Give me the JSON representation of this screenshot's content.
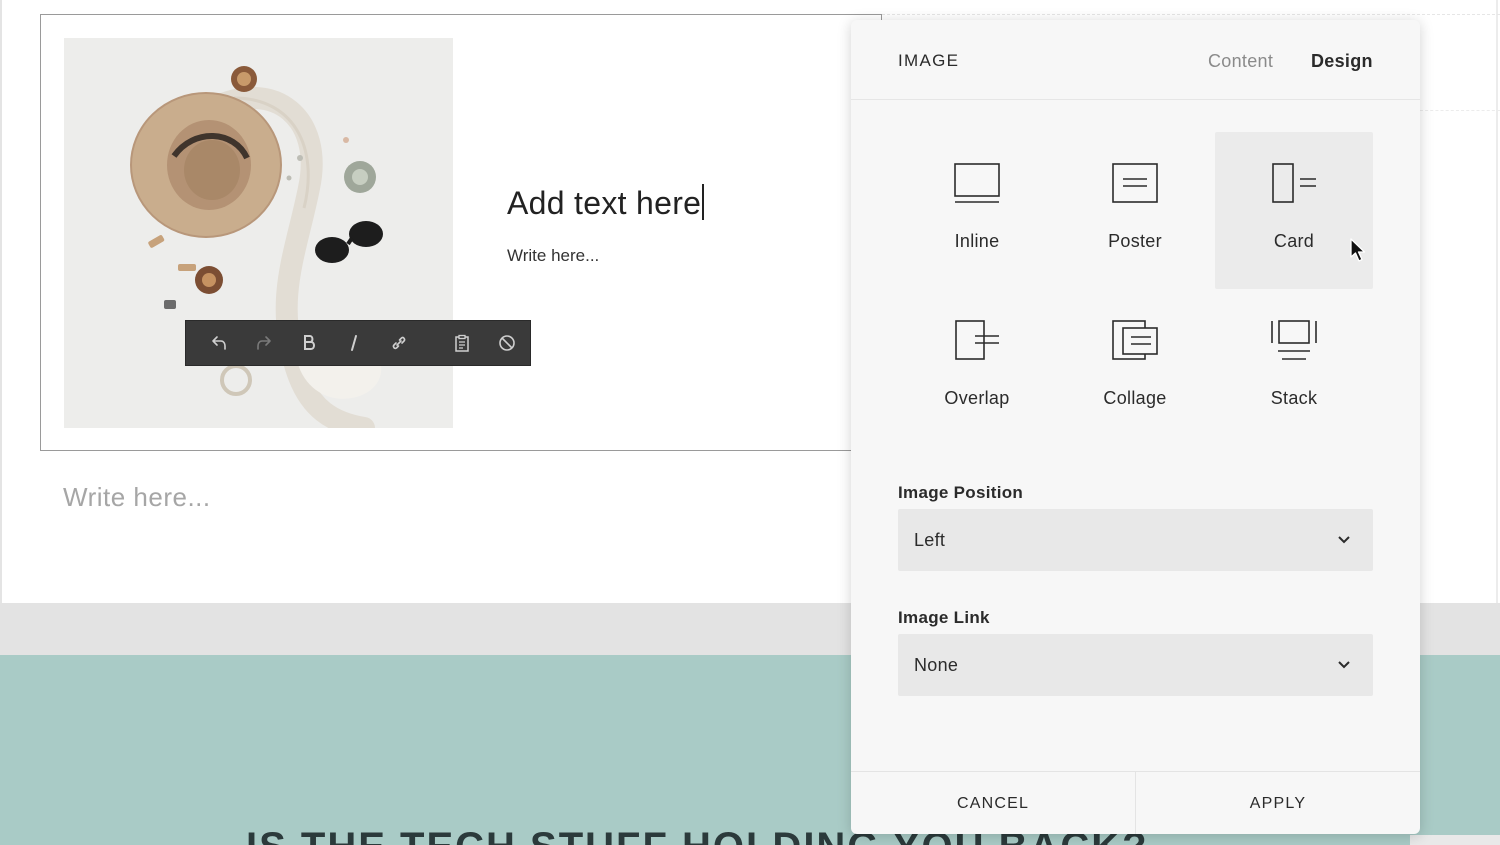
{
  "card": {
    "title": "Add text here",
    "body": "Write here..."
  },
  "editor": {
    "below_placeholder": "Write here..."
  },
  "toolbar": {
    "buttons": [
      {
        "name": "undo-icon"
      },
      {
        "name": "redo-icon"
      },
      {
        "name": "bold-icon"
      },
      {
        "name": "italic-icon"
      },
      {
        "name": "link-icon"
      },
      {
        "name": "clipboard-icon"
      },
      {
        "name": "clear-format-icon"
      }
    ]
  },
  "banner": {
    "heading": "IS THE TECH STUFF HOLDING YOU BACK?"
  },
  "panel": {
    "title": "IMAGE",
    "tabs": {
      "content": "Content",
      "design": "Design"
    },
    "active_tab": "Design",
    "layouts": [
      {
        "id": "inline",
        "label": "Inline",
        "icon": "inline-layout-icon"
      },
      {
        "id": "poster",
        "label": "Poster",
        "icon": "poster-layout-icon"
      },
      {
        "id": "card",
        "label": "Card",
        "icon": "card-layout-icon"
      },
      {
        "id": "overlap",
        "label": "Overlap",
        "icon": "overlap-layout-icon"
      },
      {
        "id": "collage",
        "label": "Collage",
        "icon": "collage-layout-icon"
      },
      {
        "id": "stack",
        "label": "Stack",
        "icon": "stack-layout-icon"
      }
    ],
    "selected_layout": "Card",
    "image_position": {
      "label": "Image Position",
      "value": "Left"
    },
    "image_link": {
      "label": "Image Link",
      "value": "None"
    },
    "footer": {
      "cancel": "CANCEL",
      "apply": "APPLY"
    }
  },
  "colors": {
    "teal_band": "#a9cbc6",
    "panel_bg": "#f7f7f7",
    "toolbar_bg": "#3a3a3a"
  }
}
